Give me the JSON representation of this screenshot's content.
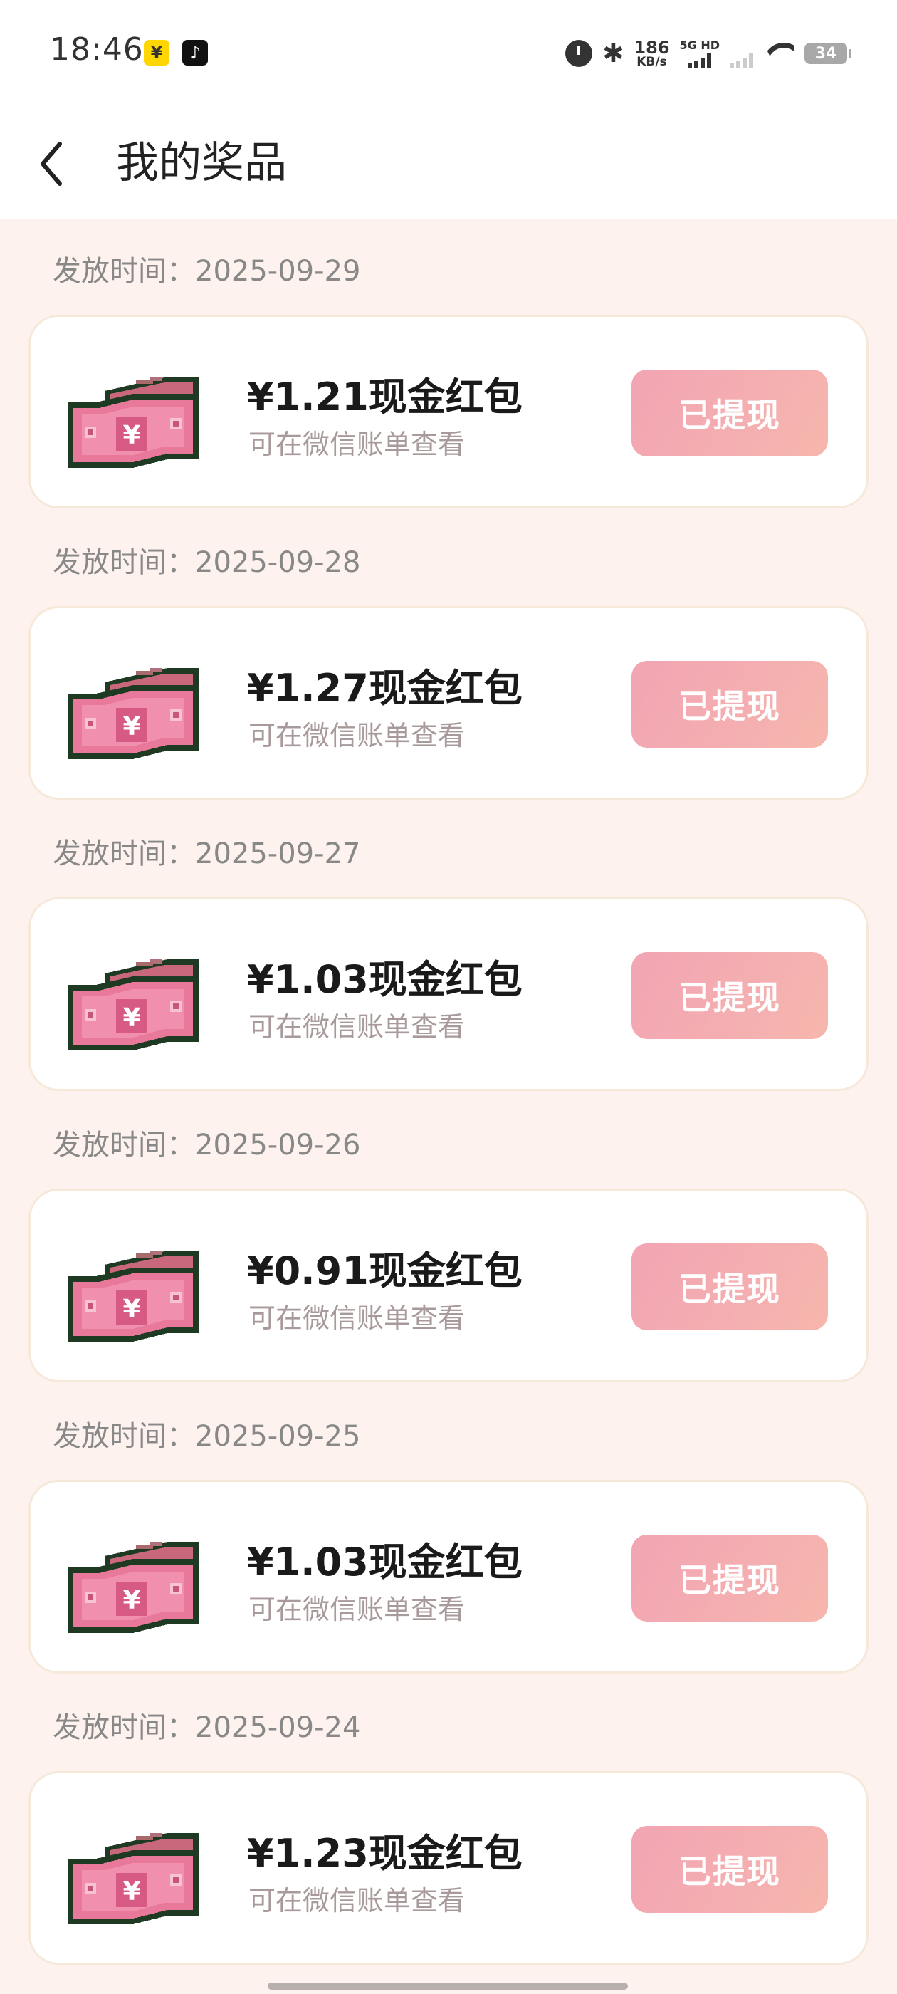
{
  "status_bar": {
    "time": "18:46",
    "app_badges": [
      "¥",
      "♪"
    ],
    "net_speed_value": "186",
    "net_speed_unit": "KB/s",
    "signal_label": "5G HD",
    "battery": "34"
  },
  "header": {
    "title": "我的奖品"
  },
  "prizes": [
    {
      "date_label": "发放时间：2025-09-29",
      "title": "¥1.21现金红包",
      "subtitle": "可在微信账单查看",
      "button": "已提现"
    },
    {
      "date_label": "发放时间：2025-09-28",
      "title": "¥1.27现金红包",
      "subtitle": "可在微信账单查看",
      "button": "已提现"
    },
    {
      "date_label": "发放时间：2025-09-27",
      "title": "¥1.03现金红包",
      "subtitle": "可在微信账单查看",
      "button": "已提现"
    },
    {
      "date_label": "发放时间：2025-09-26",
      "title": "¥0.91现金红包",
      "subtitle": "可在微信账单查看",
      "button": "已提现"
    },
    {
      "date_label": "发放时间：2025-09-25",
      "title": "¥1.03现金红包",
      "subtitle": "可在微信账单查看",
      "button": "已提现"
    },
    {
      "date_label": "发放时间：2025-09-24",
      "title": "¥1.23现金红包",
      "subtitle": "可在微信账单查看",
      "button": "已提现"
    }
  ],
  "icons": {
    "back": "chevron-left-icon",
    "cash": "cash-bill-icon",
    "bill_symbol": "¥"
  },
  "colors": {
    "background": "#fdf2ee",
    "card": "#ffffff",
    "button_gradient_start": "#f2a4b2",
    "button_gradient_end": "#f6b6ac",
    "bill_pink": "#e8799a",
    "bill_outline": "#1f3a22"
  }
}
